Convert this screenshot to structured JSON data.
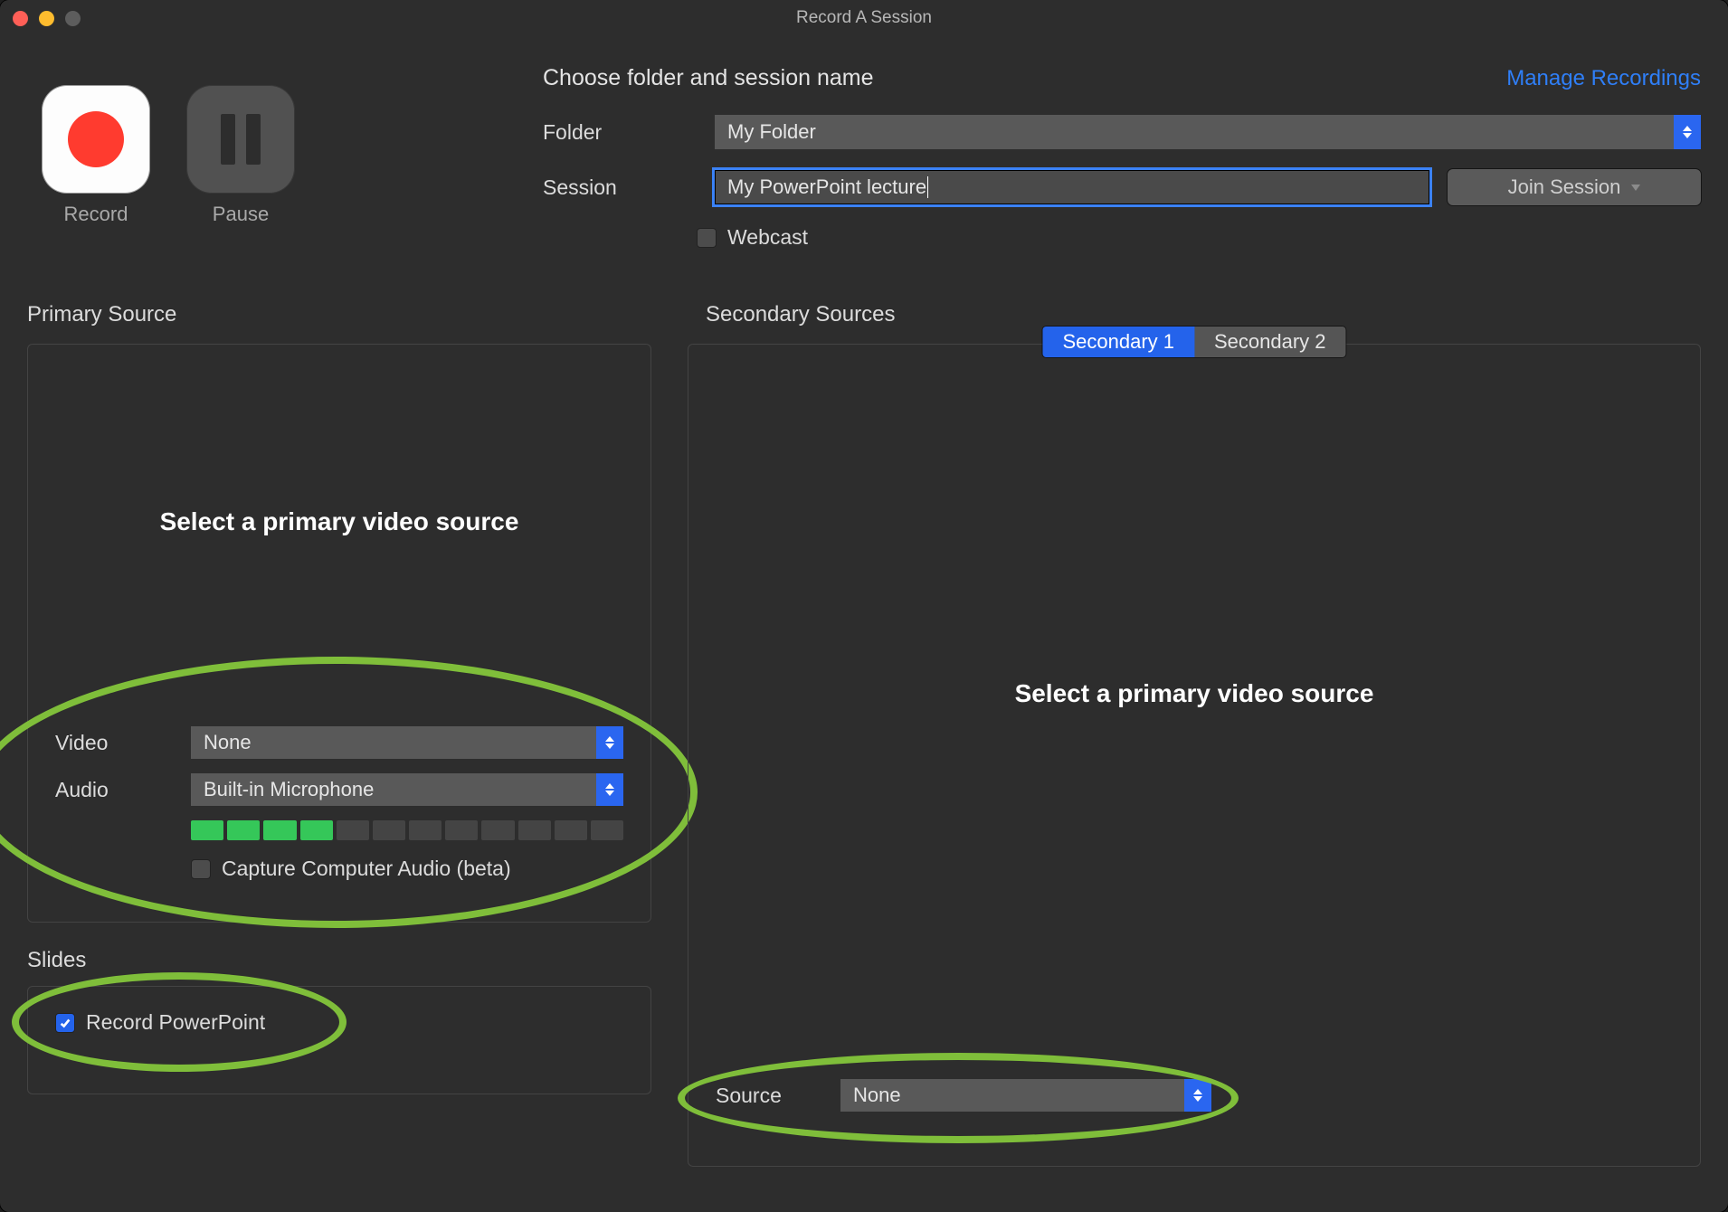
{
  "window": {
    "title": "Record A Session"
  },
  "controls": {
    "record_label": "Record",
    "pause_label": "Pause"
  },
  "form": {
    "heading": "Choose folder and session name",
    "manage_link": "Manage Recordings",
    "folder_label": "Folder",
    "folder_value": "My Folder",
    "session_label": "Session",
    "session_value": "My PowerPoint lecture",
    "join_button": "Join Session",
    "webcast_label": "Webcast",
    "webcast_checked": false
  },
  "primary": {
    "section_title": "Primary Source",
    "prompt": "Select a primary video source",
    "video_label": "Video",
    "video_value": "None",
    "audio_label": "Audio",
    "audio_value": "Built-in Microphone",
    "meter": {
      "total": 12,
      "active": 4
    },
    "capture_label": "Capture Computer Audio (beta)",
    "capture_checked": false
  },
  "slides": {
    "section_title": "Slides",
    "record_ppt_label": "Record PowerPoint",
    "record_ppt_checked": true
  },
  "secondary": {
    "section_title": "Secondary Sources",
    "tabs": [
      "Secondary 1",
      "Secondary 2"
    ],
    "active_tab": 0,
    "prompt": "Select a primary video source",
    "source_label": "Source",
    "source_value": "None"
  }
}
